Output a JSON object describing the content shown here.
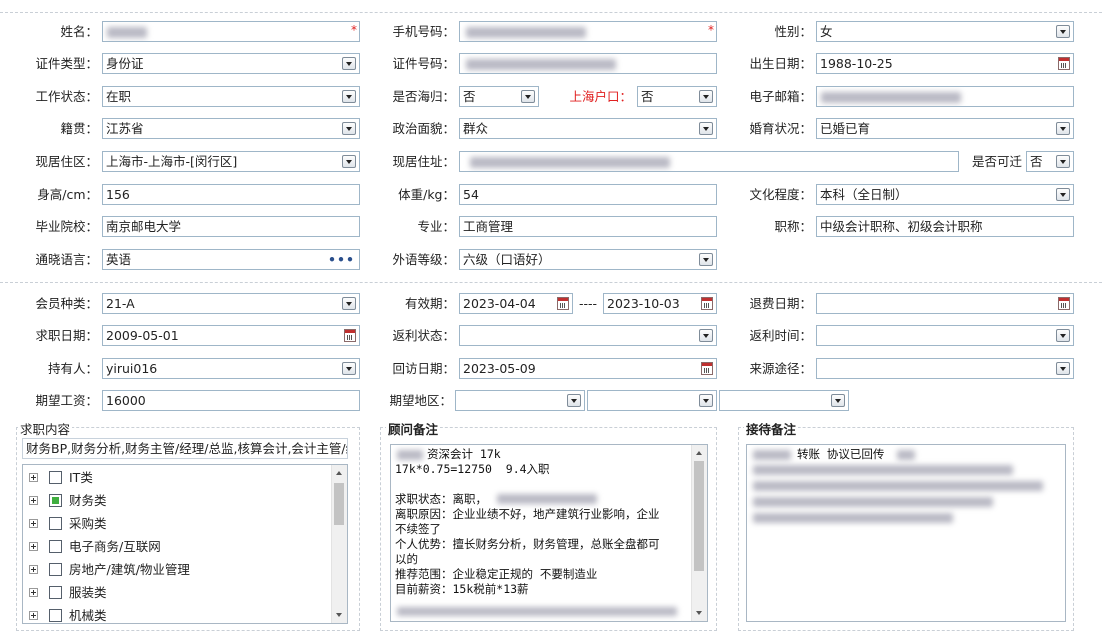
{
  "form": {
    "name_label": "姓名：",
    "phone_label": "手机号码：",
    "gender_label": "性别：",
    "gender_value": "女",
    "id_type_label": "证件类型：",
    "id_type_value": "身份证",
    "id_number_label": "证件号码：",
    "birth_label": "出生日期：",
    "birth_value": "1988-10-25",
    "work_status_label": "工作状态：",
    "work_status_value": "在职",
    "overseas_label": "是否海归：",
    "overseas_value": "否",
    "shanghai_hukou_label": "上海户口：",
    "shanghai_hukou_value": "否",
    "email_label": "电子邮箱：",
    "native_label": "籍贯：",
    "native_value": "江苏省",
    "political_label": "政治面貌：",
    "political_value": "群众",
    "marital_label": "婚育状况：",
    "marital_value": "已婚已育",
    "residence_area_label": "现居住区：",
    "residence_area_value": "上海市-上海市-[闵行区]",
    "residence_addr_label": "现居住址：",
    "relocate_label": "是否可迁",
    "relocate_value": "否",
    "height_label": "身高/cm：",
    "height_value": "156",
    "weight_label": "体重/kg：",
    "weight_value": "54",
    "education_label": "文化程度：",
    "education_value": "本科（全日制）",
    "school_label": "毕业院校：",
    "school_value": "南京邮电大学",
    "major_label": "专业：",
    "major_value": "工商管理",
    "title_label": "职称：",
    "title_value": "中级会计职称、初级会计职称",
    "language_label": "通晓语言：",
    "language_value": "英语",
    "language_more": "•••",
    "lang_level_label": "外语等级：",
    "lang_level_value": "六级（口语好）"
  },
  "member": {
    "type_label": "会员种类：",
    "type_value": "21-A",
    "valid_label": "有效期：",
    "valid_from": "2023-04-04",
    "valid_sep": "----",
    "valid_to": "2023-10-03",
    "refund_label": "退费日期：",
    "job_date_label": "求职日期：",
    "job_date_value": "2009-05-01",
    "rebate_status_label": "返利状态：",
    "rebate_time_label": "返利时间：",
    "holder_label": "持有人：",
    "holder_value": "yirui016",
    "visit_label": "回访日期：",
    "visit_value": "2023-05-09",
    "source_label": "来源途径：",
    "salary_label": "期望工资：",
    "salary_value": "16000",
    "region_label": "期望地区："
  },
  "job_panel": {
    "title": "求职内容",
    "summary": "财务BP,财务分析,财务主管/经理/总监,核算会计,会计主管/经",
    "categories": [
      {
        "label": "IT类",
        "checked": false
      },
      {
        "label": "财务类",
        "checked": true
      },
      {
        "label": "采购类",
        "checked": false
      },
      {
        "label": "电子商务/互联网",
        "checked": false
      },
      {
        "label": "房地产/建筑/物业管理",
        "checked": false
      },
      {
        "label": "服装类",
        "checked": false
      },
      {
        "label": "机械类",
        "checked": false
      }
    ]
  },
  "advisor_panel": {
    "title": "顾问备注",
    "lines": [
      "资深会计 17k",
      "17k*0.75=12750  9.4入职",
      "",
      "求职状态：离职，",
      "离职原因：企业业绩不好，地产建筑行业影响，企业",
      "不续签了",
      "个人优势：擅长财务分析，财务管理，总账全盘都可",
      "以的",
      "推荐范围：企业稳定正规的 不要制造业",
      "目前薪资：15k税前*13薪"
    ]
  },
  "reception_panel": {
    "title": "接待备注",
    "line1": "转账 协议已回传"
  }
}
